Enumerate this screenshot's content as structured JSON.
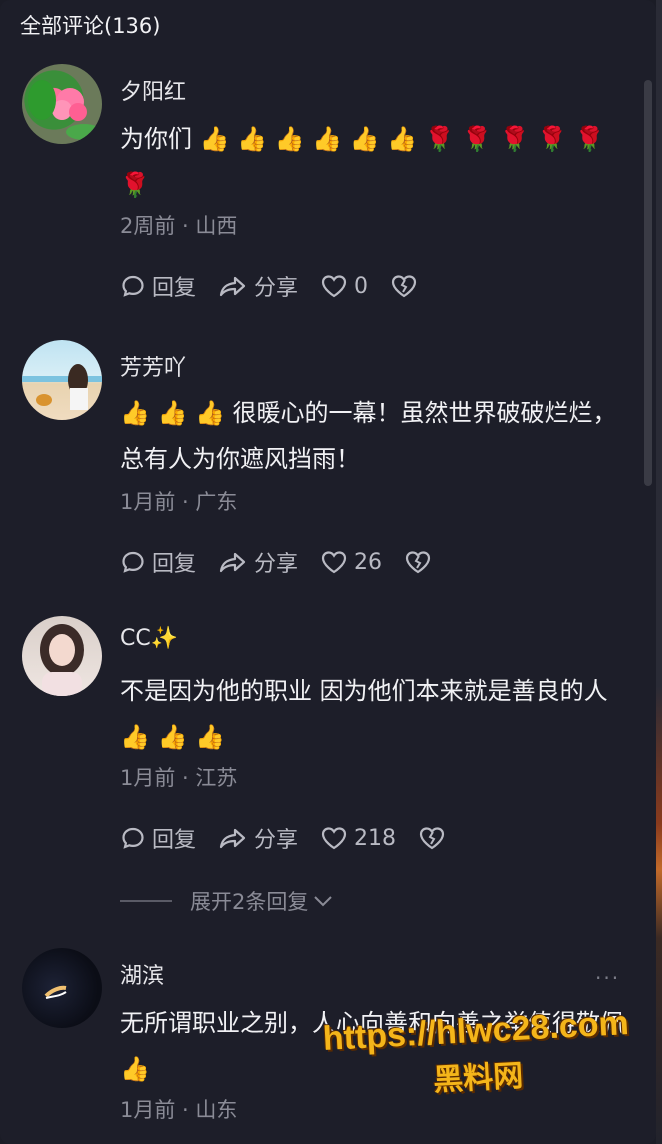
{
  "header": {
    "title": "全部评论(136)"
  },
  "comments": [
    {
      "user": "夕阳红",
      "text": "为你们 👍 👍 👍 👍 👍 👍 🌹 🌹 🌹 🌹 🌹 🌹",
      "meta": "2周前 · 山西",
      "reply_label": "回复",
      "share_label": "分享",
      "likes": "0"
    },
    {
      "user": "芳芳吖",
      "text": "👍 👍 👍 很暖心的一幕！虽然世界破破烂烂，总有人为你遮风挡雨！",
      "meta": "1月前 · 广东",
      "reply_label": "回复",
      "share_label": "分享",
      "likes": "26"
    },
    {
      "user": "CC✨",
      "text": "不是因为他的职业 因为他们本来就是善良的人 👍 👍 👍",
      "meta": "1月前 · 江苏",
      "reply_label": "回复",
      "share_label": "分享",
      "likes": "218",
      "expand_label": "展开2条回复"
    },
    {
      "user": "湖滨",
      "text": "无所谓职业之别，人心向善和向善之举值得敬佩 👍",
      "meta": "1月前 · 山东",
      "more_label": "···"
    }
  ],
  "watermark": {
    "url": "https://hlwc28.com",
    "name": "黑料网"
  }
}
